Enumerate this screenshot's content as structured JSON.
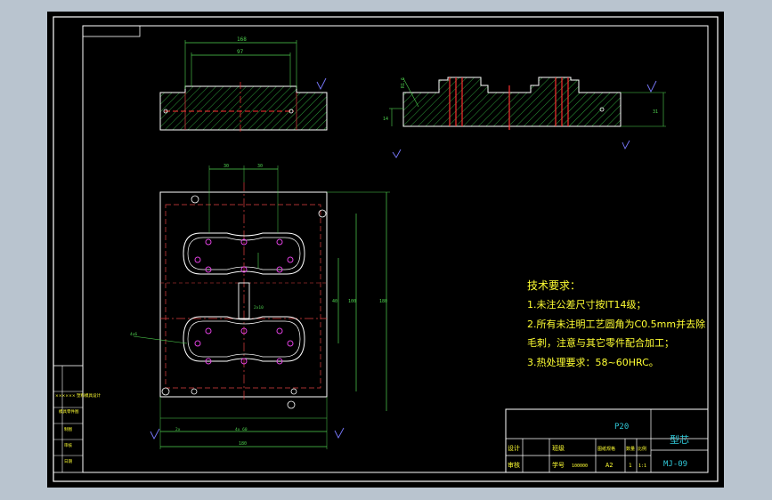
{
  "drawing": {
    "part_name": "型芯",
    "material": "P20",
    "drawing_no": "MJ-09",
    "sheet_size": "A2",
    "qty": "1",
    "scale": "1:1",
    "title_labels": {
      "designer": "设计",
      "review": "审核",
      "class": "班级",
      "student_no": "学号",
      "no_value": "100000",
      "sheet_label": "图纸规格",
      "qty_label": "数量",
      "scale_label": "比例"
    }
  },
  "tech_requirements": {
    "heading": "技术要求：",
    "lines": [
      "1.未注公差尺寸按IT14级；",
      "2.所有未注明工艺圆角为C0.5mm并去除",
      "毛刺，注意与其它零件配合加工；",
      "3.热处理要求：58~60HRC。"
    ]
  },
  "dimensions": {
    "top_left_width": "168",
    "top_left_inner": "97",
    "top_right_a": "R1.6",
    "top_right_b": "14",
    "top_right_c": "31",
    "plan_w1": "30",
    "plan_w2": "30",
    "plan_h1": "40",
    "plan_h2": "100",
    "plan_h3": "180",
    "plan_h4": "2x10",
    "plan_bottom_a": "2x",
    "plan_bottom_b": "4x 60",
    "plan_bottom_total": "180",
    "plan_callout": "4x6"
  },
  "left_strip": {
    "labels": [
      "×××××× 塑料模具设计",
      "模具零件图",
      "制图",
      "审核",
      "日期"
    ]
  },
  "colors": {
    "background": "#000000",
    "frame": "#ffffff",
    "outline": "#ffffff",
    "hatch": "#2e9e3a",
    "dimension": "#4fd34f",
    "centerline": "#e23030",
    "hidden": "#d05050",
    "holes": "#e040e0",
    "text_yellow": "#ffff33",
    "title_cyan": "#30c8d8",
    "marks": "#7a7aff"
  }
}
